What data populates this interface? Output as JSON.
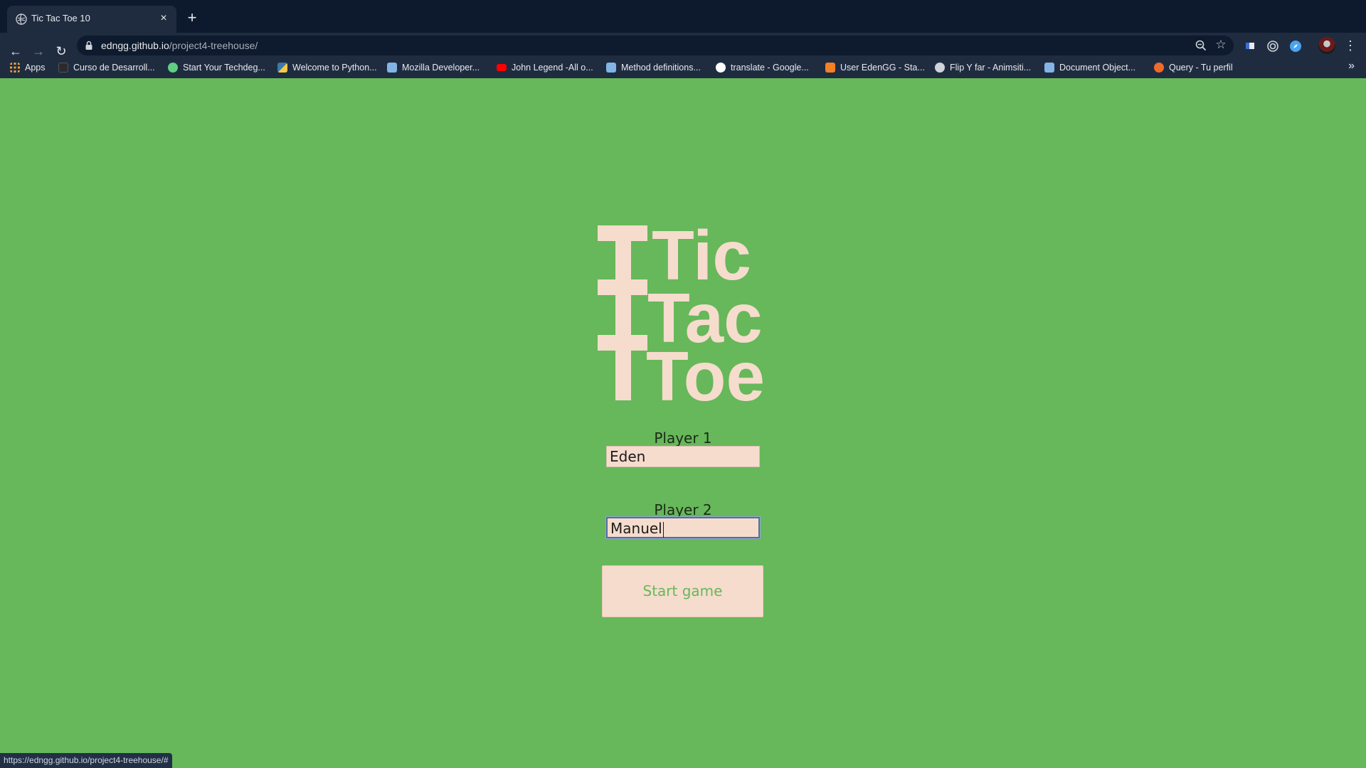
{
  "browser": {
    "tab": {
      "title": "Tic Tac Toe 10",
      "close_glyph": "×"
    },
    "new_tab_glyph": "+",
    "url": {
      "host": "edngg.github.io",
      "path": "/project4-treehouse/"
    },
    "bookmarks": [
      {
        "label": "Apps",
        "icon": "apps-grid-icon",
        "color": "#e8a33d"
      },
      {
        "label": "Curso de Desarroll...",
        "icon": "course-icon",
        "color": "#2b2b2b"
      },
      {
        "label": "Start Your Techdeg...",
        "icon": "treehouse-icon",
        "color": "#5fcf80"
      },
      {
        "label": "Welcome to Python...",
        "icon": "python-icon",
        "color": "#f2c94c"
      },
      {
        "label": "Mozilla Developer...",
        "icon": "mdn-icon",
        "color": "#83b4e6"
      },
      {
        "label": "John Legend -All o...",
        "icon": "youtube-icon",
        "color": "#ff0000"
      },
      {
        "label": "Method definitions...",
        "icon": "mdn-icon",
        "color": "#83b4e6"
      },
      {
        "label": "translate - Google...",
        "icon": "google-icon",
        "color": "#ffffff"
      },
      {
        "label": "User EdenGG - Sta...",
        "icon": "stackoverflow-icon",
        "color": "#f48024"
      },
      {
        "label": "Flip Y far - Animsiti...",
        "icon": "globe-icon",
        "color": "#cfd4da"
      },
      {
        "label": "Document Object...",
        "icon": "mdn-icon",
        "color": "#83b4e6"
      },
      {
        "label": "Query - Tu perfil",
        "icon": "query-icon",
        "color": "#f06a2a"
      }
    ],
    "more_bookmarks_glyph": "»",
    "status_url": "https://edngg.github.io/project4-treehouse/#"
  },
  "page": {
    "background": "#66b85a",
    "logo_words": [
      "Tic",
      "Tac",
      "Toe"
    ],
    "logo_color": "#f6dccd",
    "player1": {
      "label": "Player 1",
      "value": "Eden"
    },
    "player2": {
      "label": "Player 2",
      "value": "Manuel"
    },
    "start_button": "Start game"
  }
}
